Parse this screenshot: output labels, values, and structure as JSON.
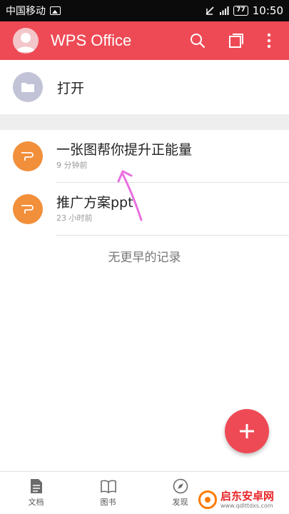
{
  "status_bar": {
    "carrier": "中国移动",
    "battery": "77",
    "time": "10:50"
  },
  "app_bar": {
    "title": "WPS Office",
    "icons": [
      "avatar-icon",
      "search-icon",
      "multi-window-icon",
      "more-vert-icon"
    ]
  },
  "open_item": {
    "label": "打开",
    "icon": "folder-icon"
  },
  "recent_docs": [
    {
      "title": "一张图帮你提升正能量",
      "time": "9 分钟前",
      "icon": "wps-presentation-icon"
    },
    {
      "title": "推广方案ppt",
      "time": "23 小时前",
      "icon": "wps-presentation-icon"
    }
  ],
  "empty_hint": "无更早的记录",
  "fab": {
    "icon": "plus-icon"
  },
  "bottom_nav": [
    {
      "label": "文档",
      "icon": "document-icon"
    },
    {
      "label": "图书",
      "icon": "book-icon"
    },
    {
      "label": "发现",
      "icon": "compass-icon"
    }
  ],
  "watermark": {
    "name": "启东安卓网",
    "url": "www.qdlttdxs.com"
  },
  "colors": {
    "accent": "#ee4a55",
    "doc_orange": "#f28f3a",
    "folder_gray": "#c2c3d6",
    "annotation": "#e96fe0"
  }
}
